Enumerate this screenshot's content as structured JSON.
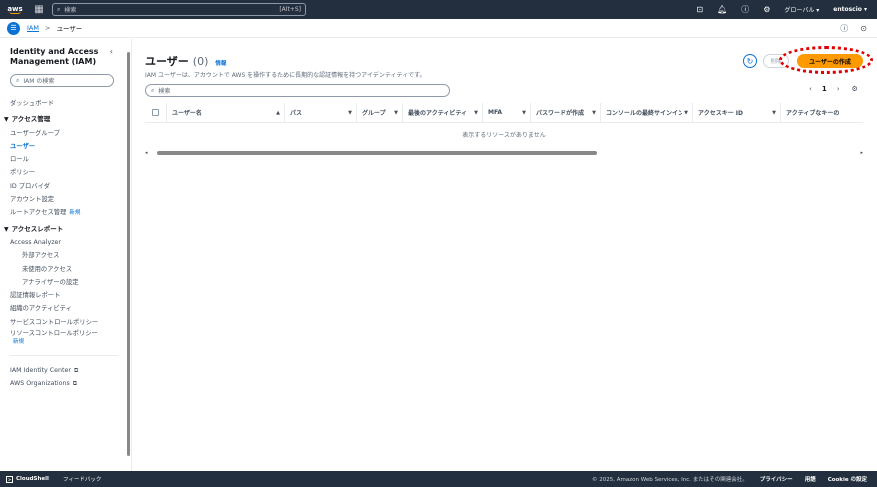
{
  "topbar": {
    "logo_text": "aws",
    "search_placeholder": "検索",
    "search_shortcut": "[Alt+S]",
    "region": "グローバル ▾",
    "account": "entoscio ▾",
    "icons": [
      "cloudshell-icon",
      "bell-icon",
      "help-icon",
      "gear-icon"
    ]
  },
  "subbar": {
    "breadcrumb_root": "IAM",
    "breadcrumb_sep": ">",
    "breadcrumb_current": "ユーザー"
  },
  "sidebar": {
    "title": "Identity and Access Management (IAM)",
    "search_placeholder": "IAM の検索",
    "dashboard": "ダッシュボード",
    "access_mgmt_head": "アクセス管理",
    "access_mgmt_items": [
      "ユーザーグループ",
      "ユーザー",
      "ロール",
      "ポリシー",
      "ID プロバイダ",
      "アカウント設定"
    ],
    "root_access": "ルートアクセス管理",
    "new_badge": "新規",
    "access_report_head": "アクセスレポート",
    "analyzer": "Access Analyzer",
    "analyzer_items": [
      "外部アクセス",
      "未使用のアクセス",
      "アナライザーの設定"
    ],
    "report_items": [
      "認証情報レポート",
      "組織のアクティビティ",
      "サービスコントロールポリシー"
    ],
    "rcp": "リソースコントロールポリシー",
    "rcp_badge": "新規",
    "ext_links": [
      "IAM Identity Center",
      "AWS Organizations"
    ]
  },
  "main": {
    "title": "ユーザー",
    "count": "(0)",
    "info": "情報",
    "description": "IAM ユーザーは、アカウントで AWS を操作するために長期的な認証情報を持つアイデンティティです。",
    "delete_label": "削除",
    "create_label": "ユーザーの作成",
    "search_placeholder": "検索",
    "page_number": "1",
    "columns": [
      "ユーザー名",
      "パス",
      "グループ",
      "最後のアクティビティ",
      "MFA",
      "パスワードが作成",
      "コンソールの最終サインイン",
      "アクセスキー ID",
      "アクティブなキーの"
    ],
    "empty_message": "表示するリソースがありません"
  },
  "footer": {
    "cloudshell": "CloudShell",
    "feedback": "フィードバック",
    "copyright": "© 2025, Amazon Web Services, Inc. またはその関連会社。",
    "privacy": "プライバシー",
    "terms": "用語",
    "cookie": "Cookie の設定"
  },
  "colors": {
    "topbar": "#232f3e",
    "accent": "#0972d3",
    "primary_button": "#ff9900",
    "highlight": "#e00000"
  }
}
